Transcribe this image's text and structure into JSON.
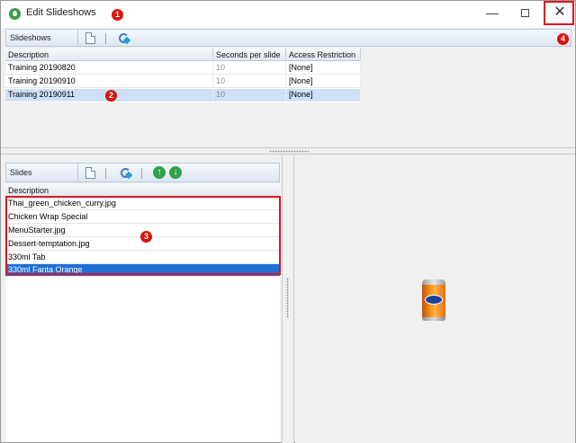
{
  "window": {
    "title": "Edit Slideshows",
    "minimize_glyph": "—",
    "close_glyph": "✕",
    "app_icon": "green-leaf-icon"
  },
  "slideshows": {
    "toolbar_label": "Slideshows",
    "columns": [
      "Description",
      "Seconds per slide",
      "Access Restriction"
    ],
    "rows": [
      {
        "description": "Training 20190820",
        "seconds": "10",
        "access": "[None]"
      },
      {
        "description": "Training 20190910",
        "seconds": "10",
        "access": "[None]"
      },
      {
        "description": "Training 20190911",
        "seconds": "10",
        "access": "[None]"
      }
    ],
    "selected_index": 2
  },
  "slides": {
    "toolbar_label": "Slides",
    "columns": [
      "Description"
    ],
    "rows": [
      "Thai_green_chicken_curry.jpg",
      "Chicken Wrap Special",
      "MenuStarter.jpg",
      "Dessert-temptation.jpg",
      "330ml Tab",
      "330ml Fanta Orange"
    ],
    "selected_index": 5
  },
  "toolbar_icons": {
    "new": "new-document-icon",
    "edit": "edit-icon",
    "move_up": "arrow-up-icon",
    "move_down": "arrow-down-icon",
    "up_glyph": "↑",
    "down_glyph": "↓"
  },
  "annotations": [
    "1",
    "2",
    "3",
    "4"
  ],
  "colors": {
    "annotation_red": "#e0141e",
    "selection_light": "#cde0f7",
    "selection_dark": "#1d6fd3"
  }
}
